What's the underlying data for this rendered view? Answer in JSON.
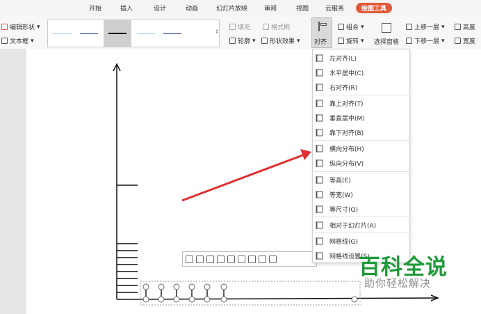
{
  "tabs": [
    "开始",
    "插入",
    "设计",
    "动画",
    "幻灯片放映",
    "审阅",
    "视图",
    "云服务",
    "绘图工具"
  ],
  "active_tab": "绘图工具",
  "ribbon": {
    "edit_shape": "编辑形状",
    "text_box": "文本框",
    "fill": "填充",
    "format_brush": "格式刷",
    "outline": "轮廓",
    "shape_effect": "形状效果",
    "align": "对齐",
    "group": "组合",
    "rotate": "旋转",
    "select_pane": "选择窗格",
    "bring_forward": "上移一层",
    "send_backward": "下移一层",
    "height": "高度",
    "width": "宽度"
  },
  "align_menu": {
    "items": [
      {
        "label": "左对齐(L)",
        "icon": "align-left-icon"
      },
      {
        "label": "水平居中(C)",
        "icon": "align-center-icon"
      },
      {
        "label": "右对齐(R)",
        "icon": "align-right-icon"
      },
      {
        "label": "靠上对齐(T)",
        "icon": "align-top-icon"
      },
      {
        "label": "垂直居中(M)",
        "icon": "align-middle-icon"
      },
      {
        "label": "靠下对齐(B)",
        "icon": "align-bottom-icon"
      },
      {
        "label": "横向分布(H)",
        "icon": "distribute-horizontal-icon"
      },
      {
        "label": "纵向分布(V)",
        "icon": "distribute-vertical-icon"
      },
      {
        "label": "等高(E)",
        "icon": "same-height-icon"
      },
      {
        "label": "等宽(W)",
        "icon": "same-width-icon"
      },
      {
        "label": "等尺寸(Q)",
        "icon": "same-size-icon"
      },
      {
        "label": "相对于幻灯片(A)",
        "icon": "relative-to-slide-icon"
      },
      {
        "label": "网格线(G)",
        "icon": "grid-lines-icon"
      },
      {
        "label": "网格线设置(S)",
        "icon": "grid-settings-icon"
      }
    ]
  },
  "watermark": {
    "title": "百科全说",
    "subtitle": "助你轻松解决"
  },
  "colors": {
    "accent": "#e05a3a",
    "arrow": "#e03030",
    "watermark": "#1f9a3a"
  }
}
